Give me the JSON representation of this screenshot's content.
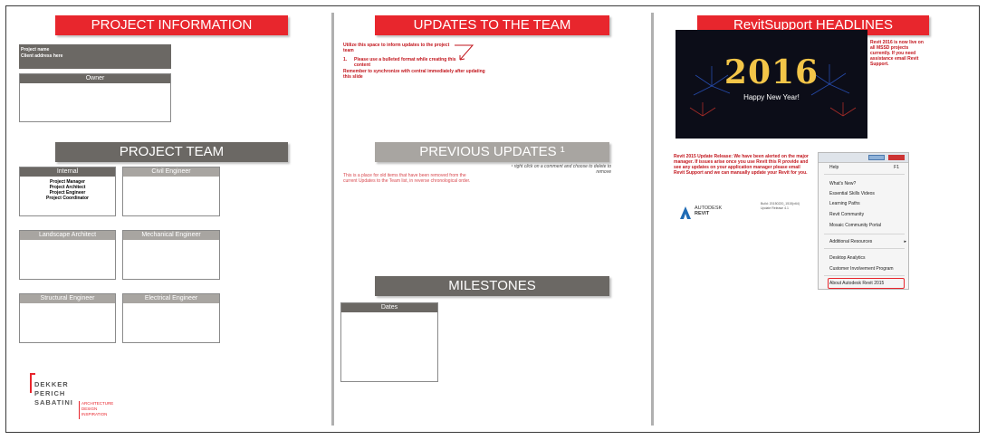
{
  "column1": {
    "title": "PROJECT INFORMATION",
    "project_name": "Project name",
    "client_address": "Client address here",
    "owner_label": "Owner",
    "team_title": "PROJECT TEAM",
    "internal": {
      "label": "Internal",
      "roles": [
        "Project Manager",
        "Project Architect",
        "Project Engineer",
        "Project Coordinator"
      ]
    },
    "boxes": {
      "civil": "Civil Engineer",
      "landscape": "Landscape Architect",
      "mechanical": "Mechanical Engineer",
      "structural": "Structural Engineer",
      "electrical": "Electrical Engineer"
    },
    "logo": {
      "line1": "DEKKER",
      "line2": "PERICH",
      "line3": "SABATINI",
      "tag1": "ARCHITECTURE",
      "tag2": "DESIGN",
      "tag3": "INSPIRATION"
    }
  },
  "column2": {
    "title": "UPDATES TO THE TEAM",
    "note1": "Utilize this space to inform updates to the project team",
    "note2_num": "1.",
    "note2": "Please use a bulleted format while creating this content",
    "note3": "Remember to synchronize with central immediately after updating this slide",
    "previous_title": "PREVIOUS UPDATES",
    "previous_sup": "¹",
    "previous_footnote": "¹ right click on a comment and choose to delete to remove",
    "previous_text": "This is a place for old items that have been removed from the current Updates to the Team list, in reverse chronological order.",
    "milestones_title": "MILESTONES",
    "dates_label": "Dates"
  },
  "column3": {
    "title": "RevitSupport HEADLINES",
    "image_year": "2016",
    "image_caption": "Happy New Year!",
    "headline1": "Revit 2016 is now live on all MSSD projects currently. If you need assistance email Revit Support.",
    "headline2": "Revit 2015 Update Release: We have been alerted on the major manager. If issues arise once you use Revit this R provide and see any updates on your application manager please email Revit Support and we can manually update your Revit for you.",
    "autodesk_brand": "AUTODESK",
    "autodesk_product": "REVIT",
    "version_info": "Build: 20150220_1515(x64) Update Release 4.1",
    "menu_items": [
      "Help",
      "What's New?",
      "Essential Skills Videos",
      "Learning Paths",
      "Revit Community",
      "Mosaic Community Portal",
      "Additional Resources",
      "Desktop Analytics",
      "Customer Involvement Program",
      "About Autodesk Revit 2015"
    ],
    "menu_shortcut": "F1",
    "colors": {
      "accent_red": "#e8262d",
      "dark_grey": "#6b6864",
      "light_grey": "#a8a5a1"
    }
  }
}
